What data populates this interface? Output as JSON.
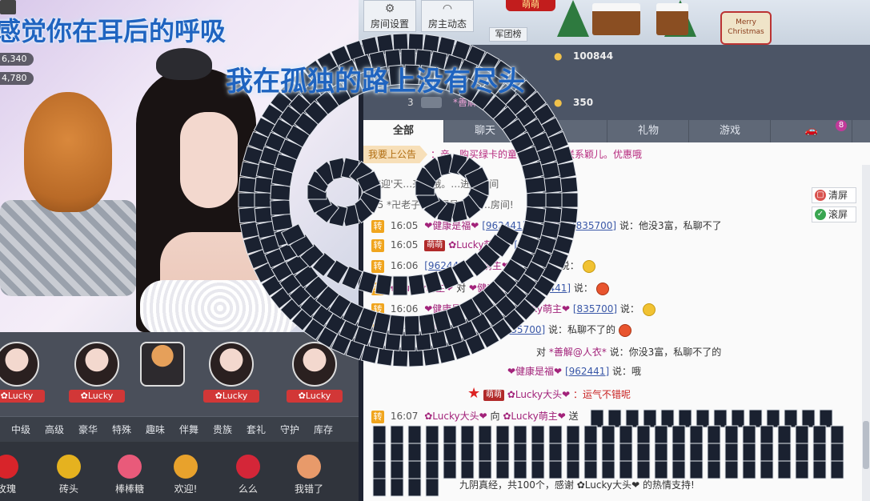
{
  "stream": {
    "stats": [
      "6,340",
      "4,780"
    ]
  },
  "top": {
    "room_settings": "房间设置",
    "owner_feed": "房主动态",
    "army_rank": "军团榜",
    "xmas_sign": "Merry Christmas",
    "name_badge": "萌萌"
  },
  "rank": {
    "rows": [
      {
        "num": "",
        "name": "",
        "coin_icon": "coin-icon",
        "value": "100844"
      },
      {
        "num": "",
        "name": "",
        "coin_icon": "coin-icon",
        "value": ""
      },
      {
        "num": "3",
        "name": "*善解@人衣",
        "coin_icon": "coin-icon",
        "value": "350"
      }
    ]
  },
  "chat": {
    "tabs": [
      "全部",
      "聊天",
      "",
      "礼物",
      "游戏",
      ""
    ],
    "tab_badge": "8",
    "announcement_label": "我要上公告",
    "announcement_text": "：亲…购买绿卡的童鞋…充值或联系颖儿。优惠哦",
    "clear_label": "清屏",
    "scroll_label": "滚屏",
    "messages": [
      {
        "text": "欢迎'天…来…哦。…进…房间"
      },
      {
        "text": "05 *卍老子…管理员 熙熙…房间!"
      },
      {
        "time": "16:05",
        "from": "❤健康是福❤",
        "from_id": "[962441]",
        "verb": "对",
        "to": "萌主❤",
        "to_id": "[835700]",
        "said": "说：他没3富，私聊不了"
      },
      {
        "time": "16:05",
        "badge": "萌萌",
        "from": "✿Lucky萌主❤",
        "from_id": "[835",
        "said": ""
      },
      {
        "time": "16:06",
        "from": "",
        "from_id": "[962441]",
        "to": "ky萌主❤",
        "to_id": "[835700]",
        "said": "说："
      },
      {
        "time": "",
        "from": "✿Lucky萌主❤",
        "to": "❤健康是福❤",
        "to_id": "[962441]",
        "said": "说："
      },
      {
        "time": "16:06",
        "from": "❤健康是福❤",
        "from_id": "[962",
        "to": "✿Lucky萌主❤",
        "to_id": "[835700]",
        "said": "说："
      },
      {
        "time": "16:06",
        "from": "*善解@人衣",
        "to": "主❤",
        "to_id": "[835700]",
        "said": "说：私聊不了的"
      },
      {
        "time": "",
        "to": "*善解@人衣*",
        "said": "说：你没3富，私聊不了的"
      },
      {
        "time": "",
        "from": "❤健康是福❤",
        "from_id": "[962441]",
        "said": "说：哦"
      },
      {
        "time": "",
        "badge": "萌萌",
        "from": "✿Lucky大头❤",
        "said": "：运气不错呢"
      },
      {
        "time": "16:07",
        "from": "✿Lucky大头❤",
        "verb": "向",
        "to": "✿Lucky萌主❤",
        "said": "送"
      },
      {
        "text": "九阴真经，共100个，感谢 ✿Lucky大头❤ 的热情支持!"
      }
    ]
  },
  "guard": {
    "items": [
      "✿Lucky",
      "✿Lucky",
      "",
      "✿Lucky",
      "✿Lucky"
    ]
  },
  "gift_tabs": [
    "中级",
    "高级",
    "豪华",
    "特殊",
    "趣味",
    "伴舞",
    "贵族",
    "套礼",
    "守护",
    "库存"
  ],
  "gifts": [
    {
      "label": "玫瑰",
      "color": "#d8242a"
    },
    {
      "label": "砖头",
      "color": "#e5b21f"
    },
    {
      "label": "棒棒糖",
      "color": "#e95a7a"
    },
    {
      "label": "欢迎!",
      "color": "#e8a22c"
    },
    {
      "label": "么么",
      "color": "#d42638"
    },
    {
      "label": "我错了",
      "color": "#e89a6a"
    }
  ],
  "overlay": {
    "lyric1": "感觉你在耳后的呼吸",
    "lyric2": "我在孤独的路上没有尽头"
  }
}
